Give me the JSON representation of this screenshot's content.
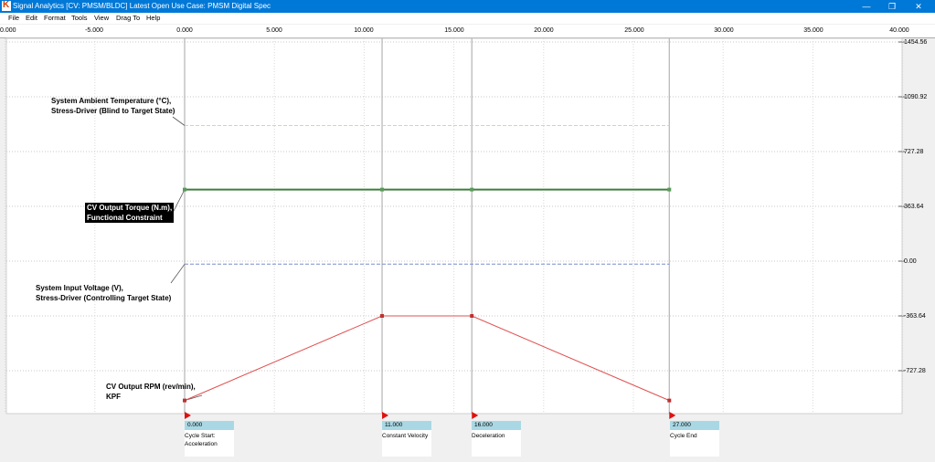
{
  "window": {
    "title": "Signal Analytics [CV: PMSM/BLDC]  Latest Open Use Case: PMSM Digital Spec",
    "controls": [
      "—",
      "❐",
      "✕"
    ]
  },
  "menu": [
    "File",
    "Edit",
    "Format",
    "Tools",
    "View",
    "Drag To",
    "Help"
  ],
  "time_axis": {
    "labels": [
      "0.000",
      "-5.000",
      "0.000",
      "5.000",
      "10.000",
      "15.000",
      "20.000",
      "25.000",
      "30.000",
      "35.000",
      "40.000"
    ]
  },
  "y_axis": {
    "labels": [
      "1454.56",
      "1090.92",
      "727.28",
      "363.64",
      "0.00",
      "-363.64",
      "-727.28"
    ]
  },
  "signals": [
    {
      "name": "system-ambient-temperature",
      "label_line1": "System Ambient Temperature (°C),",
      "label_line2": "Stress-Driver (Blind to Target State)",
      "color": "#f5c89a",
      "style": "dashed",
      "highlighted": false
    },
    {
      "name": "cv-output-torque",
      "label_line1": "CV Output Torque (N.m),",
      "label_line2": "Functional Constraint",
      "color": "#3c7d3c",
      "style": "solid",
      "highlighted": true
    },
    {
      "name": "system-input-voltage",
      "label_line1": "System Input Voltage (V),",
      "label_line2": "Stress-Driver (Controlling Target State)",
      "color": "#7b8ccc",
      "style": "dashed",
      "highlighted": false
    },
    {
      "name": "cv-output-rpm",
      "label_line1": "CV Output RPM (rev/min),",
      "label_line2": "KPF",
      "color": "#e05050",
      "style": "solid",
      "highlighted": false
    }
  ],
  "markers": [
    {
      "value": "0.000",
      "name_line1": "Cycle Start:",
      "name_line2": "Acceleration"
    },
    {
      "value": "11.000",
      "name_line1": "Constant Velocity",
      "name_line2": ""
    },
    {
      "value": "16.000",
      "name_line1": "Deceleration",
      "name_line2": ""
    },
    {
      "value": "27.000",
      "name_line1": "Cycle End",
      "name_line2": ""
    }
  ],
  "chart_data": {
    "type": "line",
    "x": [
      0,
      11,
      16,
      27
    ],
    "series": [
      {
        "name": "System Ambient Temperature (°C), Stress-Driver (Blind to Target State)",
        "values": [
          900,
          900,
          900,
          900
        ]
      },
      {
        "name": "CV Output Torque (N.m), Functional Constraint",
        "values": [
          475,
          475,
          475,
          475
        ]
      },
      {
        "name": "System Input Voltage (V), Stress-Driver (Controlling Target State)",
        "values": [
          -20,
          -20,
          -20,
          -20
        ]
      },
      {
        "name": "CV Output RPM (rev/min), KPF",
        "values": [
          -925,
          -363.64,
          -363.64,
          -925
        ]
      }
    ],
    "xlim": [
      -10,
      40
    ],
    "ylim": [
      -925,
      1454.56
    ],
    "y_ticks": [
      1454.56,
      1090.92,
      727.28,
      363.64,
      0,
      -363.64,
      -727.28
    ],
    "grid": true
  }
}
